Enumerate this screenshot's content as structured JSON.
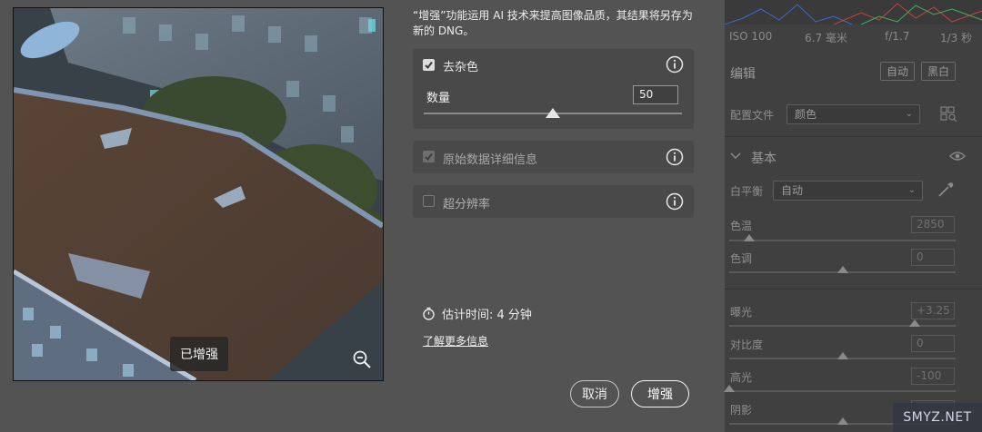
{
  "preview": {
    "badge": "已增强"
  },
  "dialog": {
    "description": "“增强”功能运用 AI 技术来提高图像品质，其结果将另存为新的 DNG。",
    "denoise": {
      "label": "去杂色",
      "checked": true
    },
    "amount": {
      "label": "数量",
      "value": "50",
      "slider_fraction": 0.5
    },
    "raw_details": {
      "label": "原始数据详细信息",
      "checked": true,
      "disabled": true
    },
    "super_resolution": {
      "label": "超分辨率",
      "checked": false
    },
    "estimate": "估计时间: 4 分钟",
    "learn_more": "了解更多信息",
    "cancel": "取消",
    "enhance": "增强"
  },
  "panel": {
    "exif": [
      "ISO 100",
      "6.7 毫米",
      "f/1.7",
      "1/3 秒"
    ],
    "edit_title": "编辑",
    "auto_button": "自动",
    "bw_button": "黑白",
    "profile_label": "配置文件",
    "profile_value": "颜色",
    "basic_title": "基本",
    "wb_label": "白平衡",
    "wb_value": "自动",
    "sliders": [
      {
        "label": "色温",
        "value": "2850",
        "fraction": 0.09
      },
      {
        "label": "色调",
        "value": "0",
        "fraction": 0.5
      },
      {
        "label": "曝光",
        "value": "+3.25",
        "fraction": 0.82
      },
      {
        "label": "对比度",
        "value": "0",
        "fraction": 0.5
      },
      {
        "label": "高光",
        "value": "-100",
        "fraction": 0.0
      },
      {
        "label": "阴影",
        "value": "",
        "fraction": 0.5
      }
    ]
  },
  "watermark": "SMYZ.NET",
  "colors": {
    "dialog_bg": "#535353",
    "card_bg": "#494949",
    "panel_bg": "#404040"
  }
}
